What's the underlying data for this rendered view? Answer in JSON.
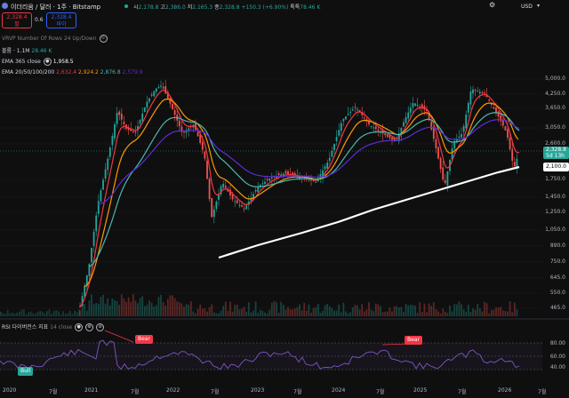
{
  "header": {
    "symbol_title": "이더리움 / 달러 · 1주 · Bitstamp",
    "ohlc_open_label": "시",
    "ohlc_open": "2,178.8",
    "ohlc_high_label": "고",
    "ohlc_high": "2,386.0",
    "ohlc_low_label": "저",
    "ohlc_low": "2,165.3",
    "ohlc_close_label": "종",
    "ohlc_close": "2,328.8",
    "change": "+150.3 (+6.90%)",
    "volume_label": "톡톡",
    "volume": "78.46 K",
    "sell_price": "2,328.4",
    "sell_label": "팔",
    "spread": "0.6",
    "buy_price": "2,328.4",
    "buy_label": "바이",
    "currency": "USD"
  },
  "indicators": {
    "vrvp": "VRVP Number Of Rows 24 Up/Down",
    "volume_label": "볼륨 · 1.1M",
    "volume_value": "28.46 K",
    "ema365_label": "EMA 365 close",
    "ema365_value": "1,958.5",
    "ema_multi_label": "EMA 20/50/100/200",
    "ema_multi_values": [
      "2,632.4",
      "2,924.2",
      "2,876.8",
      "2,579.9"
    ]
  },
  "price_axis": [
    "5,000.0",
    "4,250.0",
    "3,650.0",
    "3,050.0",
    "2,600.0",
    "1,750.0",
    "1,450.0",
    "1,250.0",
    "1,050.0",
    "890.0",
    "750.0",
    "645.0",
    "550.0",
    "465.0"
  ],
  "price_tag": {
    "price": "2,328.8",
    "countdown": "5d 13h"
  },
  "price_tag_2": "2,100.0",
  "rsi": {
    "label": "RSI 다이버전스 지표",
    "source": "14 close",
    "bear_label": "Bear",
    "bull_label": "Bull",
    "axis": [
      "80.00",
      "60.00",
      "40.00"
    ]
  },
  "time_axis": [
    "2020",
    "7월",
    "2021",
    "7월",
    "2022",
    "7월",
    "2023",
    "7월",
    "2024",
    "7월",
    "2025",
    "7월",
    "2026",
    "7월"
  ],
  "colors": {
    "ema20": "#f23645",
    "ema50": "#ff9800",
    "ema100": "#4db6ac",
    "ema200": "#5b2cd8",
    "ema365": "#ffffff",
    "up": "#26a69a",
    "down": "#ef5350",
    "rsi": "#7e57c2"
  }
}
